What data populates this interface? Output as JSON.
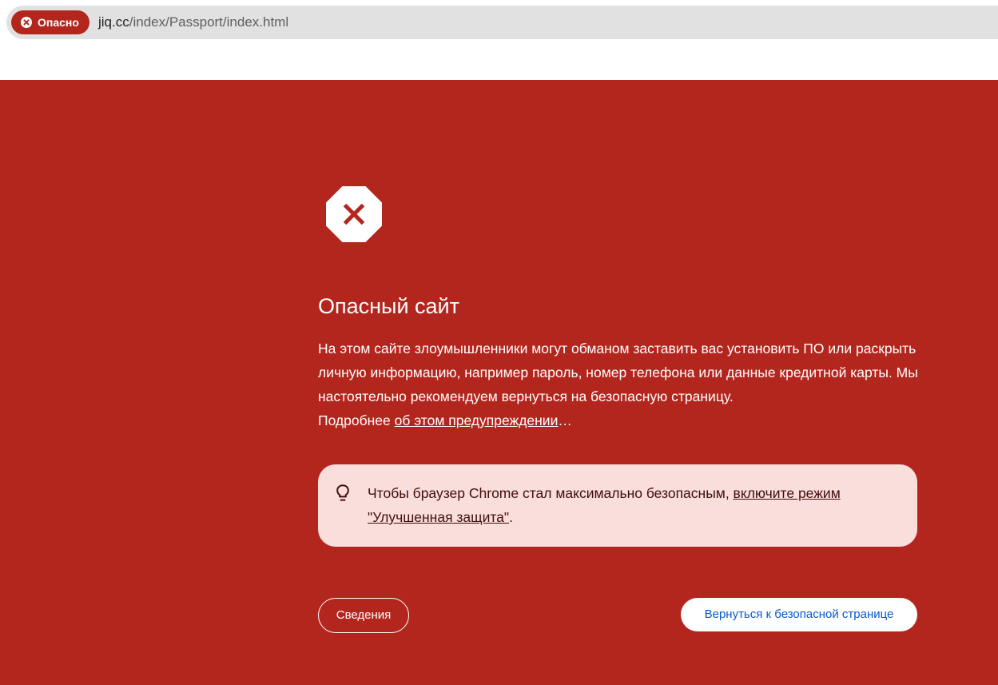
{
  "omnibox": {
    "security_chip_label": "Опасно",
    "security_chip_icon": "close-circle-icon",
    "url_host": "jiq.cc",
    "url_path": "/index/Passport/index.html"
  },
  "interstitial": {
    "icon": "danger-octagon-icon",
    "title": "Опасный сайт",
    "body_main": "На этом сайте злоумышленники могут обманом заставить вас установить ПО или раскрыть личную информацию, например пароль, номер телефона или данные кредитной карты. Мы настоятельно рекомендуем вернуться на безопасную страницу.",
    "body_more_prefix": "Подробнее ",
    "body_more_link": "об этом предупреждении",
    "body_more_suffix": "…",
    "tip_icon": "lightbulb-icon",
    "tip_text": "Чтобы браузер Chrome стал максимально безопасным, ",
    "tip_link": "включите режим \"Улучшенная защита\"",
    "tip_suffix": ".",
    "details_button": "Сведения",
    "back_button": "Вернуться к безопасной странице"
  },
  "colors": {
    "danger_red": "#b3261e",
    "tip_background": "#f9dedc",
    "tip_text": "#410e0b",
    "link_blue": "#0b57d0"
  }
}
